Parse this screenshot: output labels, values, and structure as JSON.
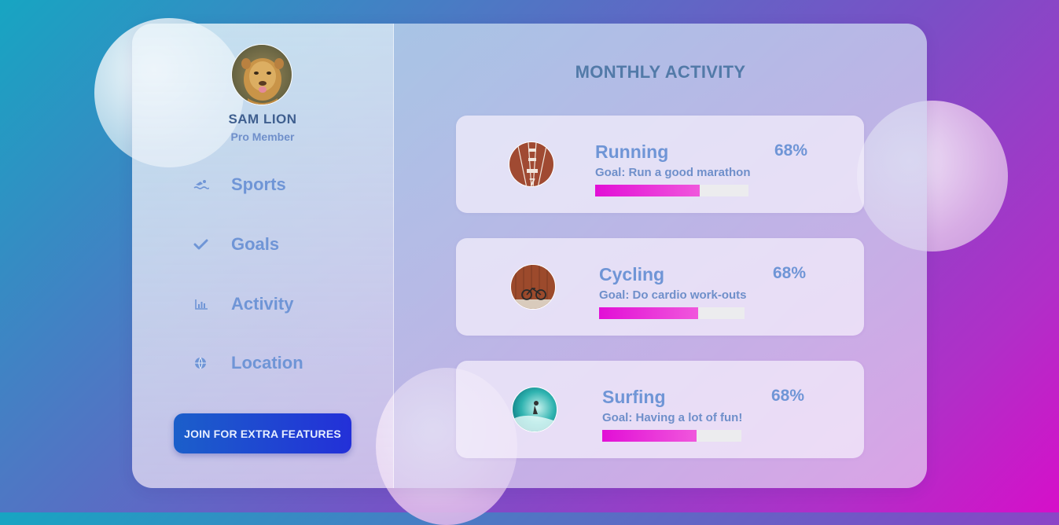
{
  "profile": {
    "name": "SAM LION",
    "role": "Pro Member",
    "avatar_icon": "lion-photo"
  },
  "nav": [
    {
      "label": "Sports",
      "icon": "swimmer-icon"
    },
    {
      "label": "Goals",
      "icon": "check-icon"
    },
    {
      "label": "Activity",
      "icon": "bar-chart-icon"
    },
    {
      "label": "Location",
      "icon": "globe-icon"
    }
  ],
  "join_button": "JOIN FOR EXTRA FEATURES",
  "main": {
    "title": "MONTHLY ACTIVITY",
    "activities": [
      {
        "title": "Running",
        "goal": "Goal: Run a good marathon",
        "percent_label": "68%",
        "progress": 0.68,
        "thumb": "running-track-photo"
      },
      {
        "title": "Cycling",
        "goal": "Goal: Do cardio work-outs",
        "percent_label": "68%",
        "progress": 0.68,
        "thumb": "bicycle-photo"
      },
      {
        "title": "Surfing",
        "goal": "Goal: Having a lot of fun!",
        "percent_label": "68%",
        "progress": 0.68,
        "thumb": "surfing-wave-photo"
      }
    ]
  },
  "colors": {
    "accent_text": "#6f95d6",
    "progress_fill": "#e20fd6",
    "button_start": "#1b5fca",
    "button_end": "#2330d8"
  }
}
